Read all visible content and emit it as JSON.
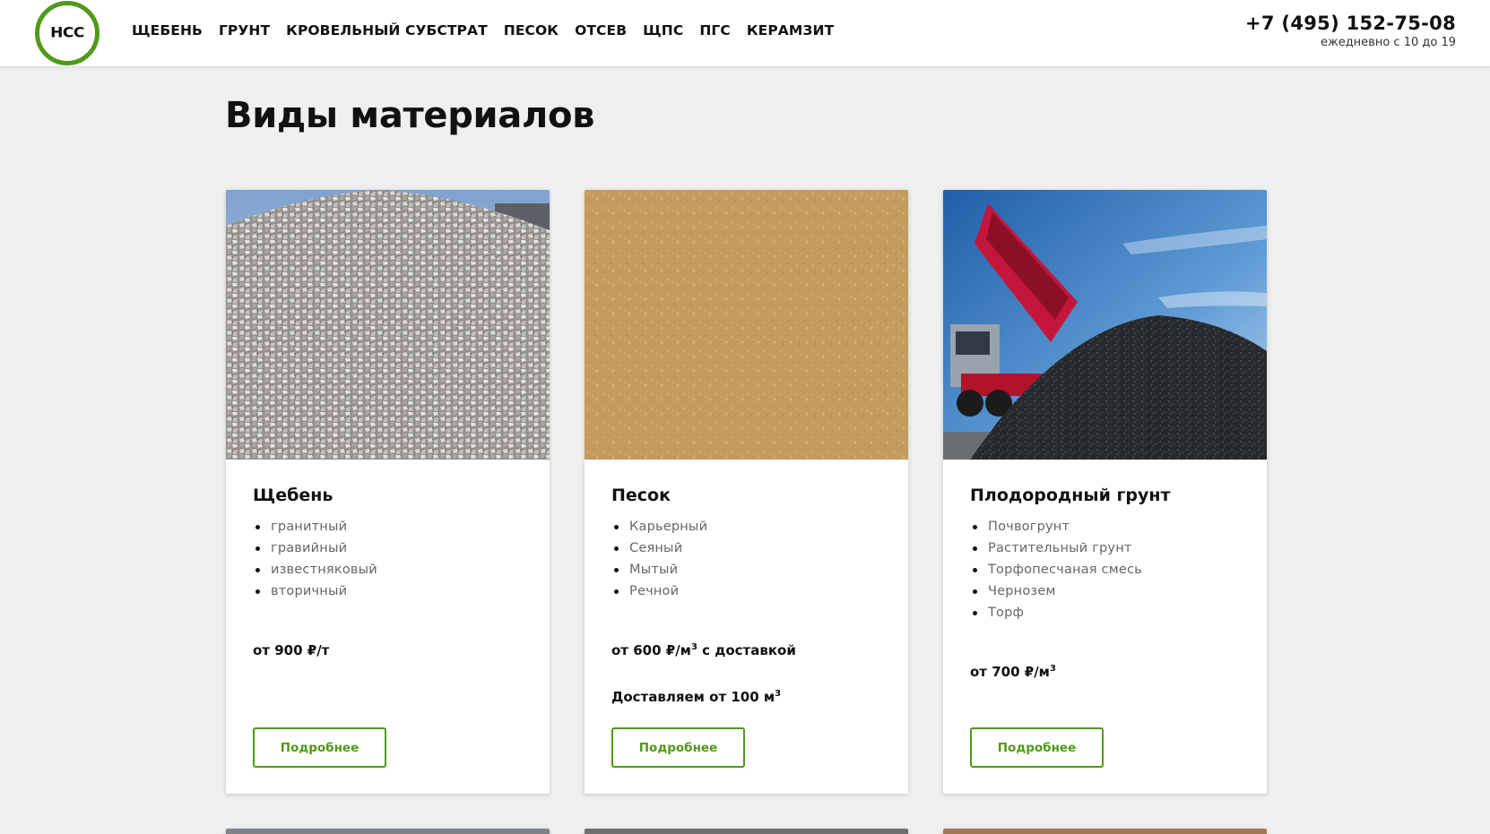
{
  "header": {
    "logo_text": "НСС",
    "nav": [
      "ЩЕБЕНЬ",
      "ГРУНТ",
      "КРОВЕЛЬНЫЙ СУБСТРАТ",
      "ПЕСОК",
      "ОТСЕВ",
      "ЩПС",
      "ПГС",
      "КЕРАМЗИТ"
    ],
    "phone": "+7 (495) 152-75-08",
    "hours": "ежедневно с 10 до 19"
  },
  "section": {
    "title": "Виды материалов"
  },
  "cards": [
    {
      "name": "Щебень",
      "items": [
        "гранитный",
        "гравийный",
        "известняковый",
        "вторичный"
      ],
      "price": "от 900 ₽/т",
      "button": "Подробнее"
    },
    {
      "name": "Песок",
      "items": [
        "Карьерный",
        "Сеяный",
        "Мытый",
        "Речной"
      ],
      "price_prefix": "от 600 ₽/м",
      "price_sup": "3",
      "price_suffix": " с доставкой",
      "note_prefix": "Доставляем от 100 м",
      "note_sup": "3",
      "button": "Подробнее"
    },
    {
      "name": "Плодородный грунт",
      "items": [
        "Почвогрунт",
        "Растительный грунт",
        "Торфопесчаная смесь",
        "Чернозем",
        "Торф"
      ],
      "price_prefix": "от 700 ₽/м",
      "price_sup": "3",
      "button": "Подробнее"
    }
  ],
  "colors": {
    "accent": "#4f9a18",
    "background": "#efefef",
    "card": "#ffffff"
  }
}
